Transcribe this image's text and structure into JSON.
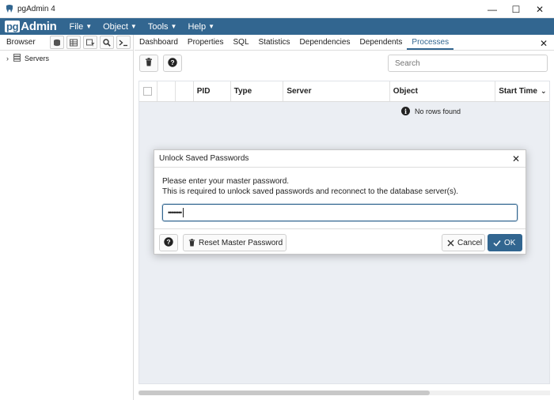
{
  "window": {
    "title": "pgAdmin 4",
    "minimize": "—",
    "maximize": "☐",
    "close": "✕"
  },
  "menubar": {
    "logo_pg": "pg",
    "logo_text": "Admin",
    "items": [
      {
        "label": "File"
      },
      {
        "label": "Object"
      },
      {
        "label": "Tools"
      },
      {
        "label": "Help"
      }
    ]
  },
  "browser": {
    "label": "Browser",
    "tree": [
      {
        "label": "Servers"
      }
    ]
  },
  "tabs": {
    "items": [
      {
        "label": "Dashboard"
      },
      {
        "label": "Properties"
      },
      {
        "label": "SQL"
      },
      {
        "label": "Statistics"
      },
      {
        "label": "Dependencies"
      },
      {
        "label": "Dependents"
      },
      {
        "label": "Processes"
      }
    ],
    "active": "Processes",
    "close": "✕"
  },
  "processes": {
    "search_placeholder": "Search",
    "columns": [
      "PID",
      "Type",
      "Server",
      "Object",
      "Start Time"
    ],
    "empty_message": "No rows found"
  },
  "dialog": {
    "title": "Unlock Saved Passwords",
    "close": "✕",
    "line1": "Please enter your master password.",
    "line2": "This is required to unlock saved passwords and reconnect to the database server(s).",
    "password_mask": "••••••••",
    "reset_label": "Reset Master Password",
    "cancel_label": "Cancel",
    "ok_label": "OK"
  },
  "colors": {
    "brand": "#326690",
    "grid_bg": "#ebeef3"
  }
}
